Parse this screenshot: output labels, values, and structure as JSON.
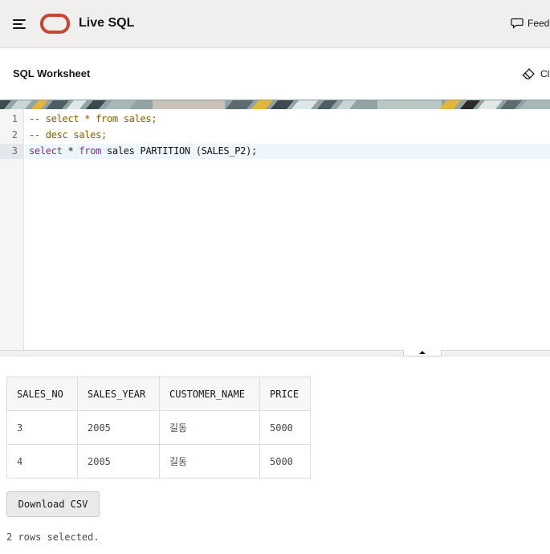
{
  "app": {
    "title": "Live SQL",
    "feedback_label": "Feed",
    "brand_color": "#c74634"
  },
  "worksheet": {
    "title": "SQL Worksheet",
    "clear_label": "Cl"
  },
  "editor": {
    "lines": [
      {
        "number": "1",
        "text": "-- select * from sales;"
      },
      {
        "number": "2",
        "text": "-- desc sales;"
      },
      {
        "number": "3",
        "kw1": "select",
        "op": " * ",
        "kw2": "from",
        "rest": " sales PARTITION (SALES_P2);"
      }
    ]
  },
  "results": {
    "columns": [
      "SALES_NO",
      "SALES_YEAR",
      "CUSTOMER_NAME",
      "PRICE"
    ],
    "rows": [
      [
        "3",
        "2005",
        "길동",
        "5000"
      ],
      [
        "4",
        "2005",
        "길동",
        "5000"
      ]
    ],
    "download_label": "Download CSV",
    "status_text": "2 rows selected."
  }
}
